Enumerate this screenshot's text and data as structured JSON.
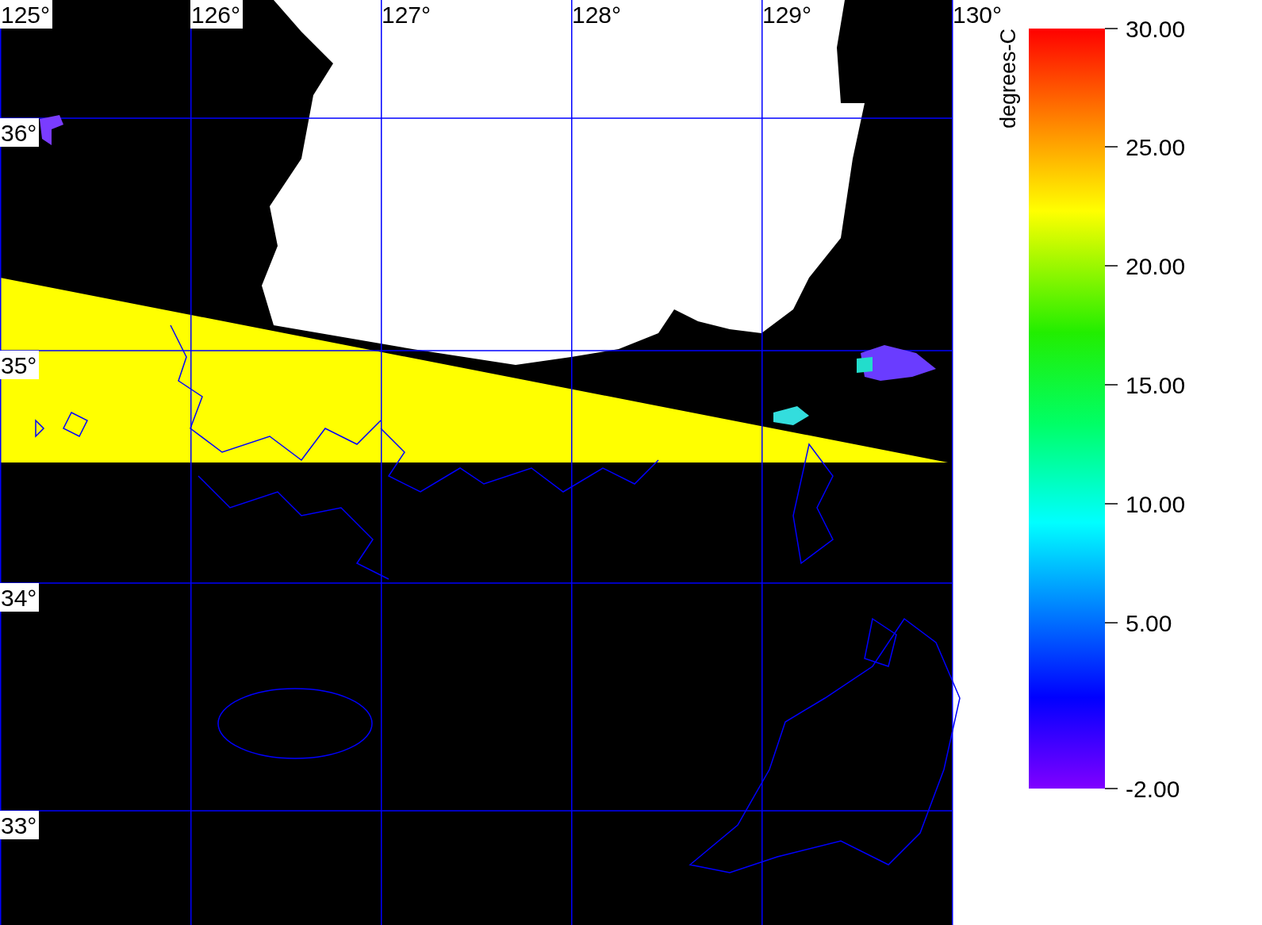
{
  "map": {
    "longitude_labels": [
      {
        "label": "125°",
        "boxed": true
      },
      {
        "label": "126°",
        "boxed": true
      },
      {
        "label": "127°",
        "boxed": false
      },
      {
        "label": "128°",
        "boxed": false
      },
      {
        "label": "129°",
        "boxed": false
      },
      {
        "label": "130°",
        "boxed": false
      }
    ],
    "latitude_labels": [
      "36°",
      "35°",
      "34°",
      "33°"
    ]
  },
  "colorbar": {
    "title": "degrees-C",
    "tick_labels": [
      "30.00",
      "25.00",
      "20.00",
      "15.00",
      "10.00",
      "5.00",
      "-2.00"
    ]
  }
}
